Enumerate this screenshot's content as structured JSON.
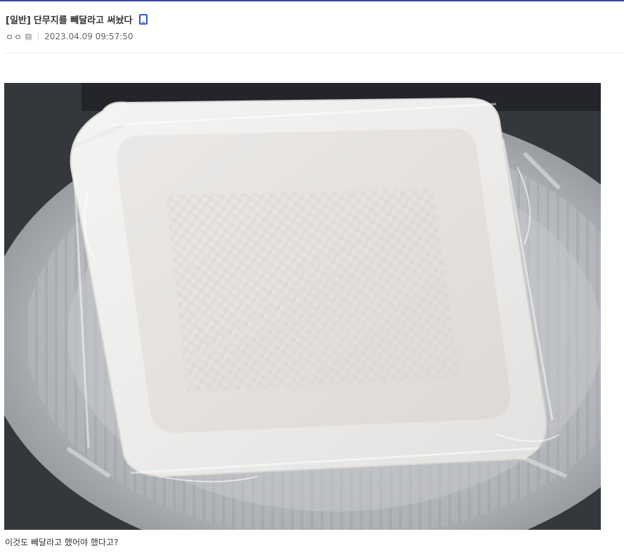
{
  "post": {
    "category": "[일반]",
    "title": "단무지를 빼달라고 써놨다",
    "author_nick": "ㅇㅇ",
    "date": "2023.04.09 09:57:50",
    "caption": "이것도 빼달라고 했어야 했다고?"
  },
  "icons": {
    "mobile": "mobile-phone-icon",
    "nick": "fixed-nick-icon"
  },
  "colors": {
    "top_rule": "#3b4890",
    "mobile_icon": "#2d5bb8"
  }
}
